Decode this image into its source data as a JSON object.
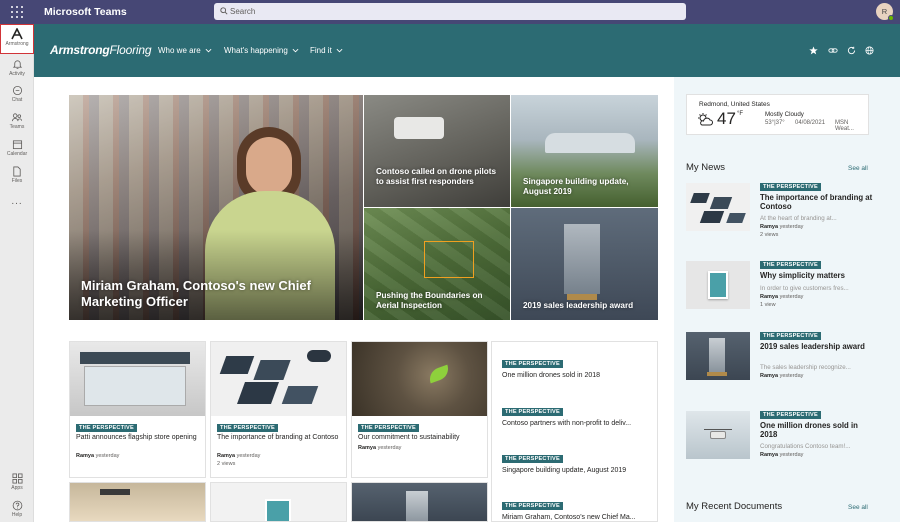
{
  "app": {
    "title": "Microsoft Teams",
    "avatar_initial": "R"
  },
  "search": {
    "placeholder": "Search"
  },
  "rail": {
    "items": [
      {
        "label": "Armstrong",
        "icon": "armstrong-logo-icon"
      },
      {
        "label": "Activity",
        "icon": "bell-icon"
      },
      {
        "label": "Chat",
        "icon": "chat-icon"
      },
      {
        "label": "Teams",
        "icon": "teams-icon"
      },
      {
        "label": "Calendar",
        "icon": "calendar-icon"
      },
      {
        "label": "Files",
        "icon": "file-icon"
      },
      {
        "label": "...",
        "icon": "more-icon"
      },
      {
        "label": "Apps",
        "icon": "apps-icon"
      },
      {
        "label": "Help",
        "icon": "help-icon"
      }
    ]
  },
  "site": {
    "brand_bold": "Armstrong",
    "brand_light": "Flooring",
    "nav": [
      "Who we are",
      "What's happening",
      "Find it"
    ],
    "icons": [
      "star-icon",
      "link-icon",
      "refresh-icon",
      "globe-icon"
    ]
  },
  "hero": {
    "main_caption": "Miriam Graham, Contoso's new Chief Marketing Officer",
    "tiles": [
      "Contoso called on drone pilots to assist first responders",
      "Singapore building update, August 2019",
      "Pushing the Boundaries on Aerial Inspection",
      "2019 sales leadership award"
    ]
  },
  "cards": [
    {
      "tag": "THE PERSPECTIVE",
      "title": "Patti announces flagship store opening",
      "author": "Ramya",
      "time": "yesterday",
      "views": ""
    },
    {
      "tag": "THE PERSPECTIVE",
      "title": "The importance of branding at Contoso",
      "author": "Ramya",
      "time": "yesterday",
      "views": "2 views"
    },
    {
      "tag": "THE PERSPECTIVE",
      "title": "Our commitment to sustainability",
      "author": "Ramya",
      "time": "yesterday",
      "views": ""
    }
  ],
  "perspective_list": [
    {
      "tag": "THE PERSPECTIVE",
      "title": "One million drones sold in 2018"
    },
    {
      "tag": "THE PERSPECTIVE",
      "title": "Contoso partners with non-profit to deliv..."
    },
    {
      "tag": "THE PERSPECTIVE",
      "title": "Singapore building update, August 2019"
    },
    {
      "tag": "THE PERSPECTIVE",
      "title": "Miriam Graham, Contoso's new Chief Ma..."
    }
  ],
  "weather": {
    "location": "Redmond, United States",
    "temp": "47",
    "unit": "°F",
    "condition": "Mostly Cloudy",
    "range": "53°|37°",
    "date": "04/08/2021",
    "source": "MSN Weat..."
  },
  "my_news": {
    "title": "My News",
    "see_all": "See all",
    "items": [
      {
        "tag": "THE PERSPECTIVE",
        "title": "The importance of branding at Contoso",
        "excerpt": "At the heart of branding at...",
        "author": "Ramya",
        "time": "yesterday",
        "views": "2 views"
      },
      {
        "tag": "THE PERSPECTIVE",
        "title": "Why simplicity matters",
        "excerpt": "In order to give customers fres...",
        "author": "Ramya",
        "time": "yesterday",
        "views": "1 view"
      },
      {
        "tag": "THE PERSPECTIVE",
        "title": "2019 sales leadership award",
        "excerpt": "The sales leadership recognize...",
        "author": "Ramya",
        "time": "yesterday",
        "views": ""
      },
      {
        "tag": "THE PERSPECTIVE",
        "title": "One million drones sold in 2018",
        "excerpt": "Congratulations Contoso team!...",
        "author": "Ramya",
        "time": "yesterday",
        "views": ""
      }
    ]
  },
  "recent_docs": {
    "title": "My Recent Documents",
    "see_all": "See all"
  }
}
